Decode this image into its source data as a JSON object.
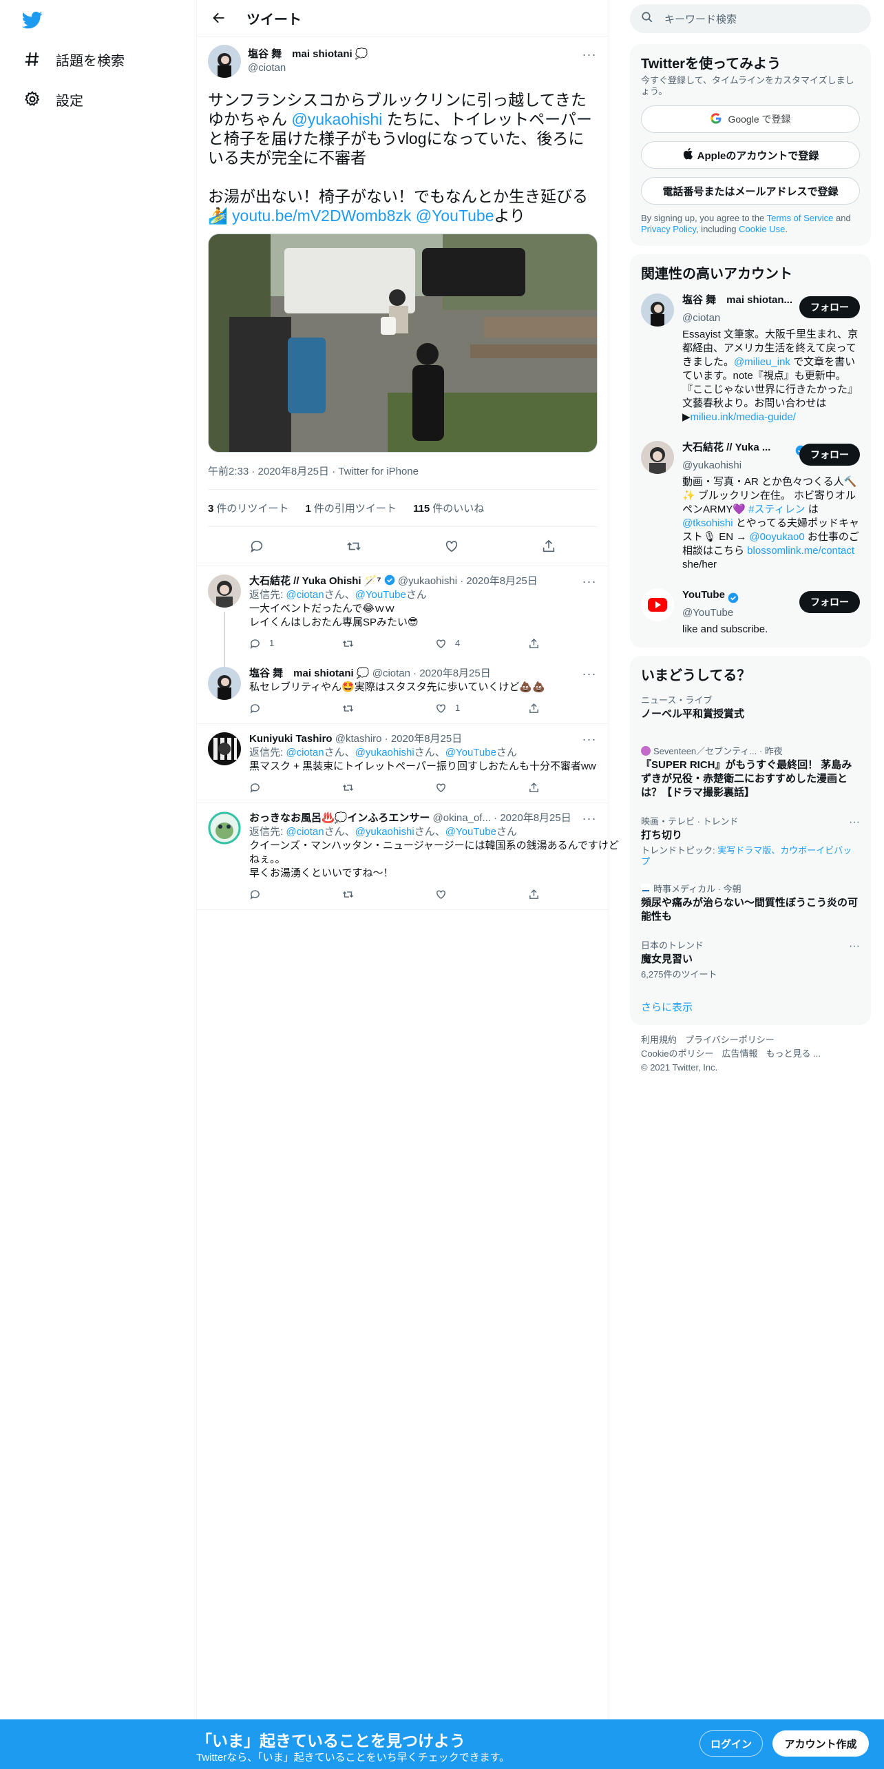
{
  "nav": {
    "explore_label": "話題を検索",
    "settings_label": "設定"
  },
  "header": {
    "title": "ツイート"
  },
  "focal": {
    "name": "塩谷 舞　mai shiotani",
    "handle": "@ciotan",
    "text_1": "サンフランシスコからブルックリンに引っ越してきたゆかちゃん ",
    "mention": "@yukaohishi",
    "text_2": " たちに、トイレットペーパーと椅子を届けた様子がもうvlogになっていた、後ろにいる夫が完全に不審者\n\nお湯が出ない！椅子がない！でもなんとか生き延びる",
    "link": "youtu.be/mV2DWomb8zk",
    "link_mention": "@YouTube",
    "suffix": "より",
    "meta": "午前2:33 · 2020年8月25日 · Twitter for iPhone",
    "retweets": "3",
    "retweets_label": "件のリツイート",
    "quotes": "1",
    "quotes_label": "件の引用ツイート",
    "likes": "115",
    "likes_label": "件のいいね"
  },
  "replies": [
    {
      "name": "大石結花 // Yuka Ohishi 🪄⁷",
      "handle": "@yukaohishi",
      "date": "· 2020年8月25日",
      "reply_to_prefix": "返信先: ",
      "reply_to_1": "@ciotan",
      "reply_to_sep1": "さん、",
      "reply_to_2": "@YouTube",
      "reply_to_sep2": "さん",
      "reply_to_3": "",
      "reply_to_end": "",
      "text": "一大イベントだったんで😂ｗｗ\nレイくんはしおたん専属SPみたい😎",
      "replies": "1",
      "retweets": "",
      "likes": "4"
    },
    {
      "name": "塩谷 舞　mai shiotani",
      "handle": "@ciotan",
      "date": "· 2020年8月25日",
      "text": "私セレブリティやん🤩実際はスタスタ先に歩いていくけど💩💩",
      "replies": "",
      "retweets": "",
      "likes": "1"
    },
    {
      "name": "Kuniyuki Tashiro",
      "handle": "@ktashiro",
      "date": "· 2020年8月25日",
      "reply_to_prefix": "返信先: ",
      "reply_to_1": "@ciotan",
      "reply_to_sep1": "さん、",
      "reply_to_2": "@yukaohishi",
      "reply_to_sep2": "さん、",
      "reply_to_3": "@YouTube",
      "reply_to_end": "さん",
      "text": "黒マスク + 黒装束にトイレットペーパー振り回すしおたんも十分不審者ww",
      "replies": "",
      "retweets": "",
      "likes": ""
    },
    {
      "name": "おっきなお風呂♨️💭インふろエンサー",
      "handle": "@okina_of...",
      "date": "· 2020年8月25日",
      "reply_to_prefix": "返信先: ",
      "reply_to_1": "@ciotan",
      "reply_to_sep1": "さん、",
      "reply_to_2": "@yukaohishi",
      "reply_to_sep2": "さん、",
      "reply_to_3": "@YouTube",
      "reply_to_end": "さん",
      "text": "クイーンズ・マンハッタン・ニュージャージーには韓国系の銭湯あるんですけどねぇ。。\n早くお湯湧くといいですね〜！",
      "replies": "",
      "retweets": "",
      "likes": ""
    }
  ],
  "right": {
    "search_placeholder": "キーワード検索",
    "signup": {
      "title": "Twitterを使ってみよう",
      "subtitle": "今すぐ登録して、タイムラインをカスタマイズしましょう。",
      "google": "Google で登録",
      "apple": "Appleのアカウントで登録",
      "phone": "電話番号またはメールアドレスで登録",
      "legal_1": "By signing up, you agree to the ",
      "terms": "Terms of Service",
      "legal_2": " and ",
      "privacy": "Privacy Policy",
      "legal_3": ", including ",
      "cookie": "Cookie Use",
      "legal_4": "."
    },
    "related": {
      "title": "関連性の高いアカウント",
      "follow_label": "フォロー",
      "accounts": [
        {
          "name": "塩谷 舞　mai shiotan...",
          "handle": "@ciotan",
          "bio_1": "Essayist 文筆家。大阪千里生まれ、京都経由、アメリカ生活を終えて戻ってきました。",
          "bio_link": "@milieu_ink",
          "bio_2": " で文章を書いています。note『視点』も更新中。『ここじゃない世界に行きたかった』文藝春秋より。お問い合わせは▶",
          "bio_link2": "milieu.ink/media-guide/"
        },
        {
          "name": "大石結花 // Yuka ...",
          "handle": "@yukaohishi",
          "bio_1": "動画・写真・AR とか色々つくる人🔨✨ ブルックリン在住。 ホビ寄りオルペンARMY💜 ",
          "bio_link": "#スティレン",
          "bio_2": " は ",
          "bio_link2": "@tksohishi",
          "bio_3": " とやってる夫婦ポッドキャスト🎙 EN → ",
          "bio_link3": "@0oyukao0",
          "bio_4": " お仕事のご相談はこちら ",
          "bio_link4": "blossomlink.me/contact",
          "bio_5": "　she/her"
        },
        {
          "name": "YouTube",
          "handle": "@YouTube",
          "bio_1": "like and subscribe."
        }
      ]
    },
    "trends": {
      "title": "いまどうしてる？",
      "items": [
        {
          "cat": "ニュース・ライブ",
          "title": "ノーベル平和賞授賞式"
        },
        {
          "cat": "Seventeen／セブンティ... · 昨夜",
          "title": "『SUPER RICH』がもうすぐ最終回！ 茅島みずきが兄役・赤楚衛二におすすめした漫画とは？【ドラマ撮影裏話】"
        },
        {
          "cat": "映画・テレビ · トレンド",
          "title": "打ち切り",
          "extra_prefix": "トレンドトピック: ",
          "extra": "実写ドラマ版、カウボーイビバップ"
        },
        {
          "cat": "時事メディカル · 今朝",
          "title": "頻尿や痛みが治らない～間質性ぼうこう炎の可能性も"
        },
        {
          "cat": "日本のトレンド",
          "title": "魔女見習い",
          "extra": "6,275件のツイート"
        }
      ],
      "more": "さらに表示"
    },
    "footer": {
      "terms": "利用規約",
      "privacy": "プライバシーポリシー",
      "cookie": "Cookieのポリシー",
      "ads": "広告情報",
      "more": "もっと見る ...",
      "copyright": "© 2021 Twitter, Inc."
    }
  },
  "bottombar": {
    "headline": "「いま」起きていることを見つけよう",
    "sub": "Twitterなら、「いま」起きていることをいち早くチェックできます。",
    "login": "ログイン",
    "signup": "アカウント作成"
  },
  "colors": {
    "accent": "#1d9bf0",
    "text": "#0f1419",
    "muted": "#536471"
  }
}
